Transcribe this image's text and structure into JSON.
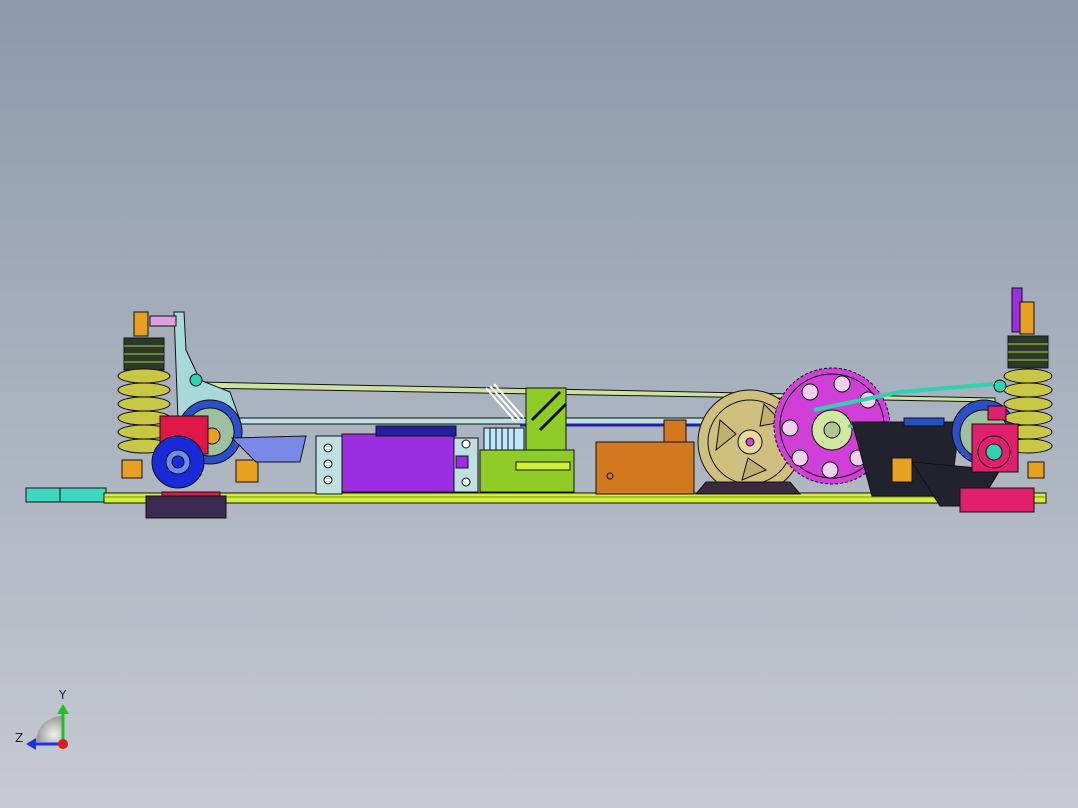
{
  "viewport": {
    "background_top": "#8d9aac",
    "background_bottom": "#c6cad2"
  },
  "model": {
    "name": "rc-car-chassis-side-view",
    "colors": {
      "chassis_plate": "#d2f03a",
      "shock_spring": "#c9c846",
      "shock_body": "#2a3a2a",
      "shock_cap": "#e8a020",
      "front_hub": "#1a2ad8",
      "steering_knuckle": "#e01848",
      "rear_hub": "#e0206a",
      "servo": "#9a2ee0",
      "esc": "#90cc28",
      "battery_box": "#d2781e",
      "motor": "#d0c080",
      "spur_gear": "#d040d8",
      "belt": "#30d0b0",
      "heat_sink": "#bfe8ff",
      "frame_dark": "#22222e",
      "link_bar": "#cfe0a0"
    }
  },
  "triad": {
    "y_label": "Y",
    "z_label": "Z",
    "y_color": "#20c020",
    "z_color": "#1c34e0",
    "x_color": "#e01818"
  }
}
